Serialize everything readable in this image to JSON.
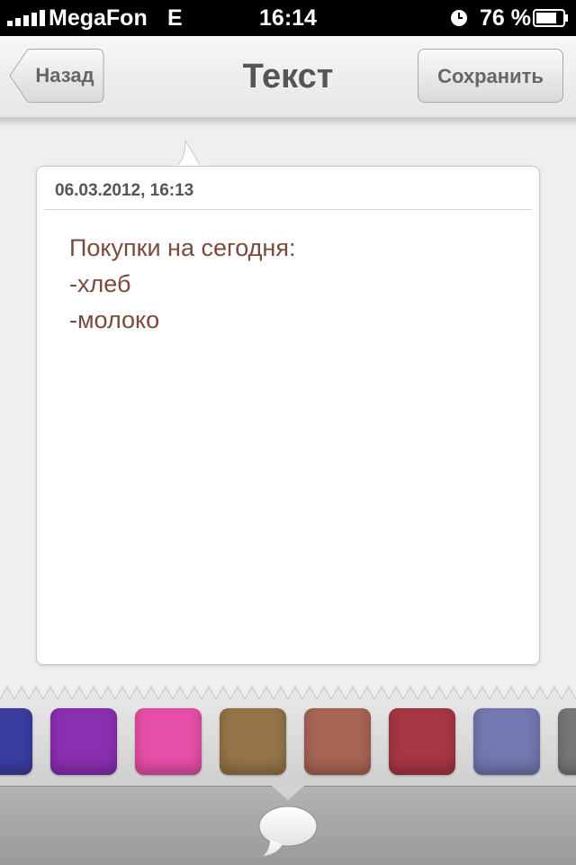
{
  "status_bar": {
    "carrier": "MegaFon",
    "network": "E",
    "time": "16:14",
    "battery": "76 %",
    "icons": [
      "signal-icon",
      "alarm-icon",
      "battery-icon"
    ]
  },
  "nav": {
    "back_label": "Назад",
    "title": "Текст",
    "save_label": "Сохранить"
  },
  "note": {
    "date": "06.03.2012, 16:13",
    "body": "Покупки на сегодня:\n-хлеб\n-молоко",
    "text_color": "#7a4a3a"
  },
  "palette": {
    "colors": [
      "#3b3ea0",
      "#8a2fb0",
      "#e64fa8",
      "#957548",
      "#a86555",
      "#a83645",
      "#7378b0",
      "#777777"
    ]
  },
  "toolbar": {
    "icon": "speech-bubble-icon"
  }
}
